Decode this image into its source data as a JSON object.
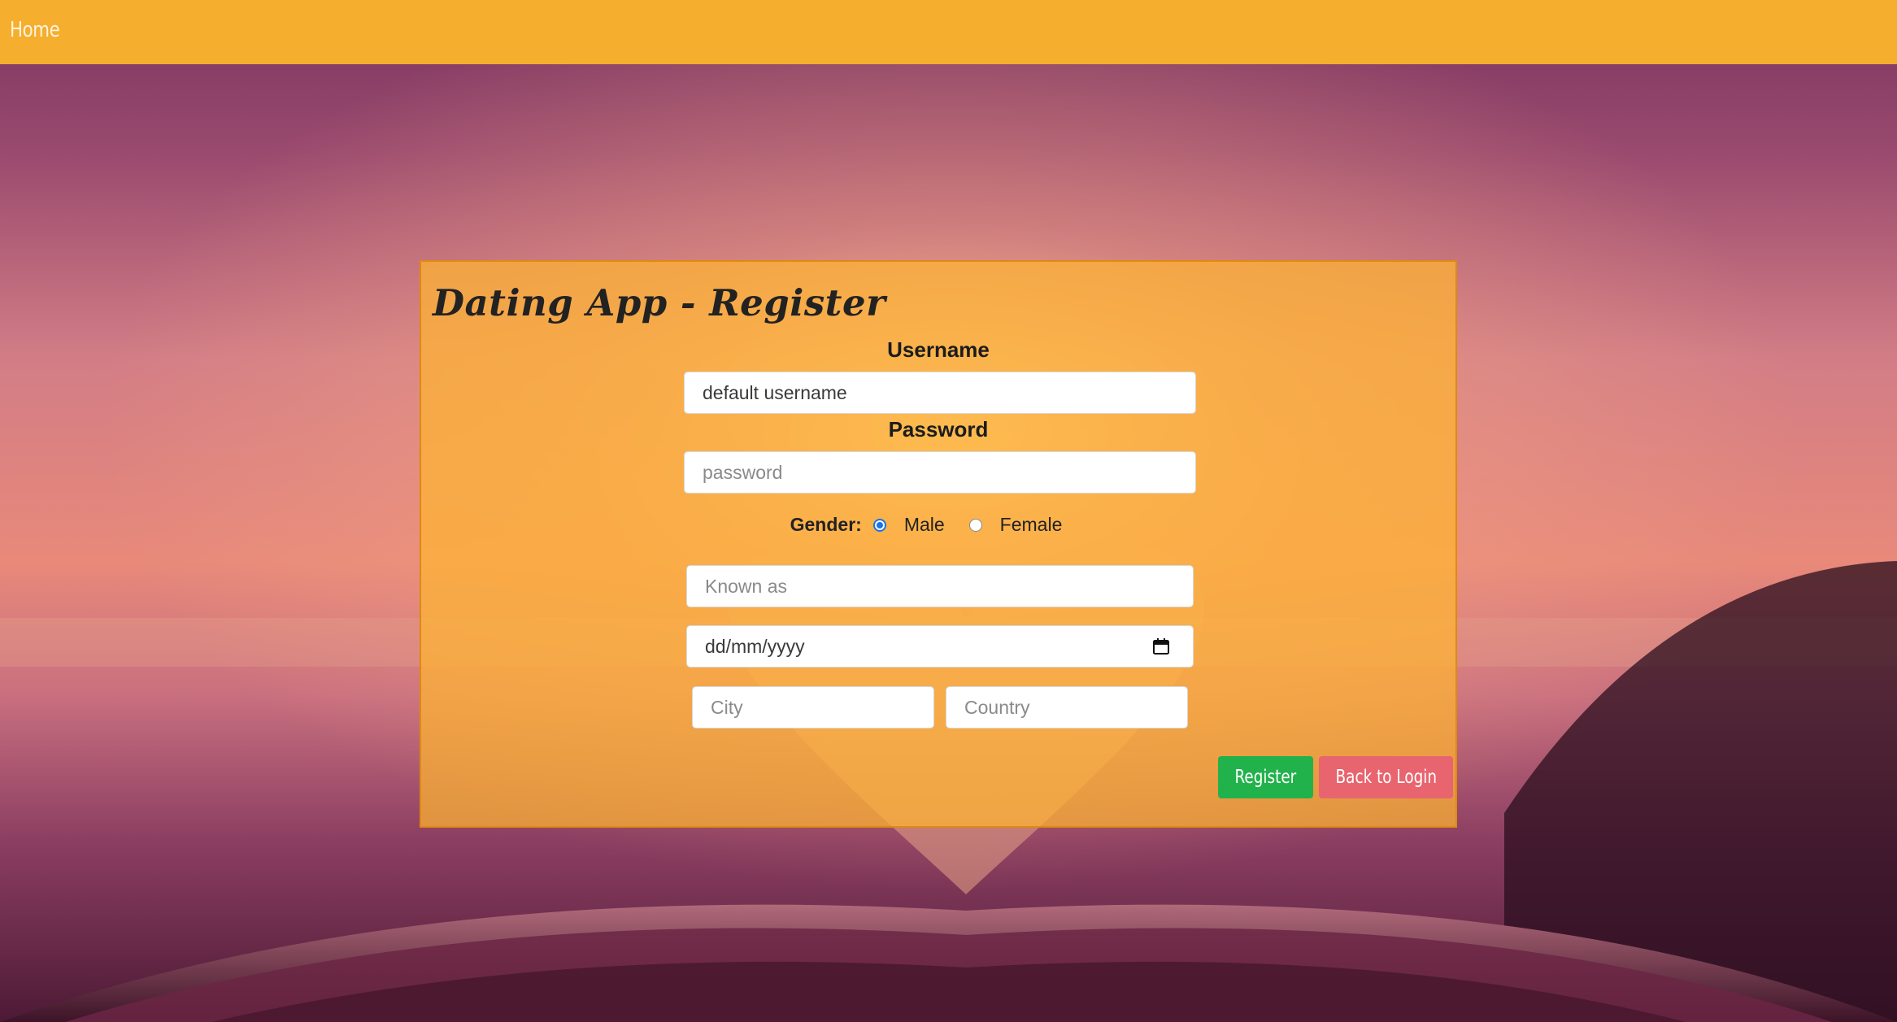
{
  "navbar": {
    "home_label": "Home",
    "color": "#f5ae2d"
  },
  "register_form": {
    "title": "Dating App - Register",
    "username_label": "Username",
    "username_value": "default username",
    "password_label": "Password",
    "password_placeholder": "password",
    "gender_label": "Gender:",
    "gender_options": [
      "Male",
      "Female"
    ],
    "gender_selected": "Male",
    "known_as_placeholder": "Known as",
    "dob_placeholder": "dd/mm/yyyy",
    "city_placeholder": "City",
    "country_placeholder": "Country",
    "register_label": "Register",
    "back_label": "Back to Login",
    "register_color": "#22b24c",
    "back_color": "#e8646e"
  },
  "icons": {
    "date_picker": "calendar-icon",
    "background": "open-book-heart-sunset"
  }
}
